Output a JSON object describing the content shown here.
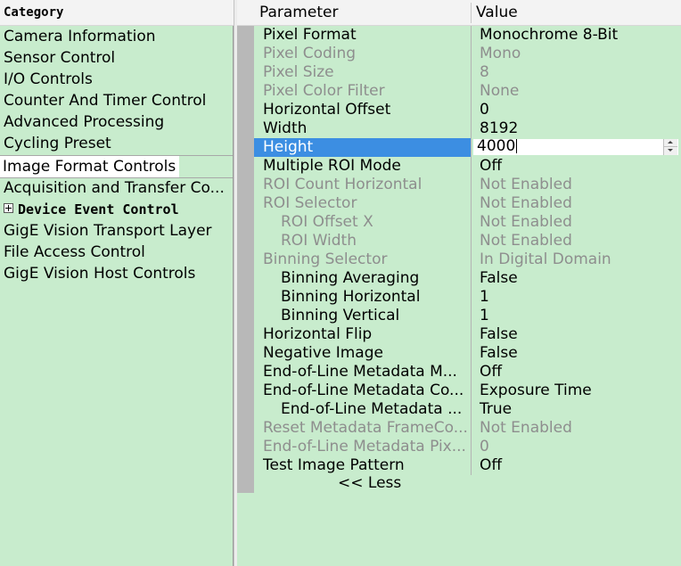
{
  "category_panel": {
    "header": "Category",
    "items": [
      {
        "label": "Camera Information",
        "selected": false,
        "bold": false
      },
      {
        "label": "Sensor Control",
        "selected": false,
        "bold": false
      },
      {
        "label": "I/O Controls",
        "selected": false,
        "bold": false
      },
      {
        "label": "Counter And Timer Control",
        "selected": false,
        "bold": false
      },
      {
        "label": "Advanced Processing",
        "selected": false,
        "bold": false
      },
      {
        "label": "Cycling Preset",
        "selected": false,
        "bold": false
      },
      {
        "label": "Image Format Controls",
        "selected": true,
        "bold": false
      },
      {
        "label": "Acquisition and Transfer Co...",
        "selected": false,
        "bold": false
      },
      {
        "label": "Device Event Control",
        "selected": false,
        "bold": true,
        "icon": "plus-box-icon"
      },
      {
        "label": "GigE Vision Transport Layer",
        "selected": false,
        "bold": false
      },
      {
        "label": "File Access Control",
        "selected": false,
        "bold": false
      },
      {
        "label": "GigE Vision Host Controls",
        "selected": false,
        "bold": false
      }
    ]
  },
  "grid": {
    "header": {
      "parameter": "Parameter",
      "value": "Value"
    },
    "rows": [
      {
        "name": "Pixel Format",
        "value": "Monochrome 8-Bit",
        "disabled": false,
        "indent": false
      },
      {
        "name": "Pixel Coding",
        "value": "Mono",
        "disabled": true,
        "indent": false
      },
      {
        "name": "Pixel Size",
        "value": "8",
        "disabled": true,
        "indent": false
      },
      {
        "name": "Pixel Color Filter",
        "value": "None",
        "disabled": true,
        "indent": false
      },
      {
        "name": "Horizontal Offset",
        "value": "0",
        "disabled": false,
        "indent": false
      },
      {
        "name": "Width",
        "value": "8192",
        "disabled": false,
        "indent": false
      },
      {
        "name": "Height",
        "value": "4000",
        "disabled": false,
        "indent": false,
        "selected": true,
        "editing": true
      },
      {
        "name": "Multiple ROI Mode",
        "value": "Off",
        "disabled": false,
        "indent": false
      },
      {
        "name": "ROI Count Horizontal",
        "value": "Not Enabled",
        "disabled": true,
        "indent": false
      },
      {
        "name": "ROI Selector",
        "value": "Not Enabled",
        "disabled": true,
        "indent": false
      },
      {
        "name": "ROI Offset X",
        "value": "Not Enabled",
        "disabled": true,
        "indent": true
      },
      {
        "name": "ROI Width",
        "value": "Not Enabled",
        "disabled": true,
        "indent": true
      },
      {
        "name": "Binning Selector",
        "value": "In Digital Domain",
        "disabled": true,
        "indent": false
      },
      {
        "name": "Binning Averaging",
        "value": "False",
        "disabled": false,
        "indent": true
      },
      {
        "name": "Binning Horizontal",
        "value": "1",
        "disabled": false,
        "indent": true
      },
      {
        "name": "Binning Vertical",
        "value": "1",
        "disabled": false,
        "indent": true
      },
      {
        "name": "Horizontal Flip",
        "value": "False",
        "disabled": false,
        "indent": false
      },
      {
        "name": "Negative Image",
        "value": "False",
        "disabled": false,
        "indent": false
      },
      {
        "name": "End-of-Line Metadata M...",
        "value": "Off",
        "disabled": false,
        "indent": false
      },
      {
        "name": "End-of-Line Metadata Co...",
        "value": "Exposure Time",
        "disabled": false,
        "indent": false
      },
      {
        "name": "End-of-Line Metadata ...",
        "value": "True",
        "disabled": false,
        "indent": true
      },
      {
        "name": "Reset Metadata FrameCo...",
        "value": "Not Enabled",
        "disabled": true,
        "indent": false
      },
      {
        "name": "End-of-Line Metadata Pix...",
        "value": "0",
        "disabled": true,
        "indent": false
      },
      {
        "name": "Test Image Pattern",
        "value": "Off",
        "disabled": false,
        "indent": false
      }
    ],
    "less_link": "<< Less"
  },
  "colors": {
    "panel_bg": "#c8eccd",
    "selection": "#3c8ee2",
    "disabled_text": "#8e8e8e",
    "gutter": "#b8b8b8"
  }
}
